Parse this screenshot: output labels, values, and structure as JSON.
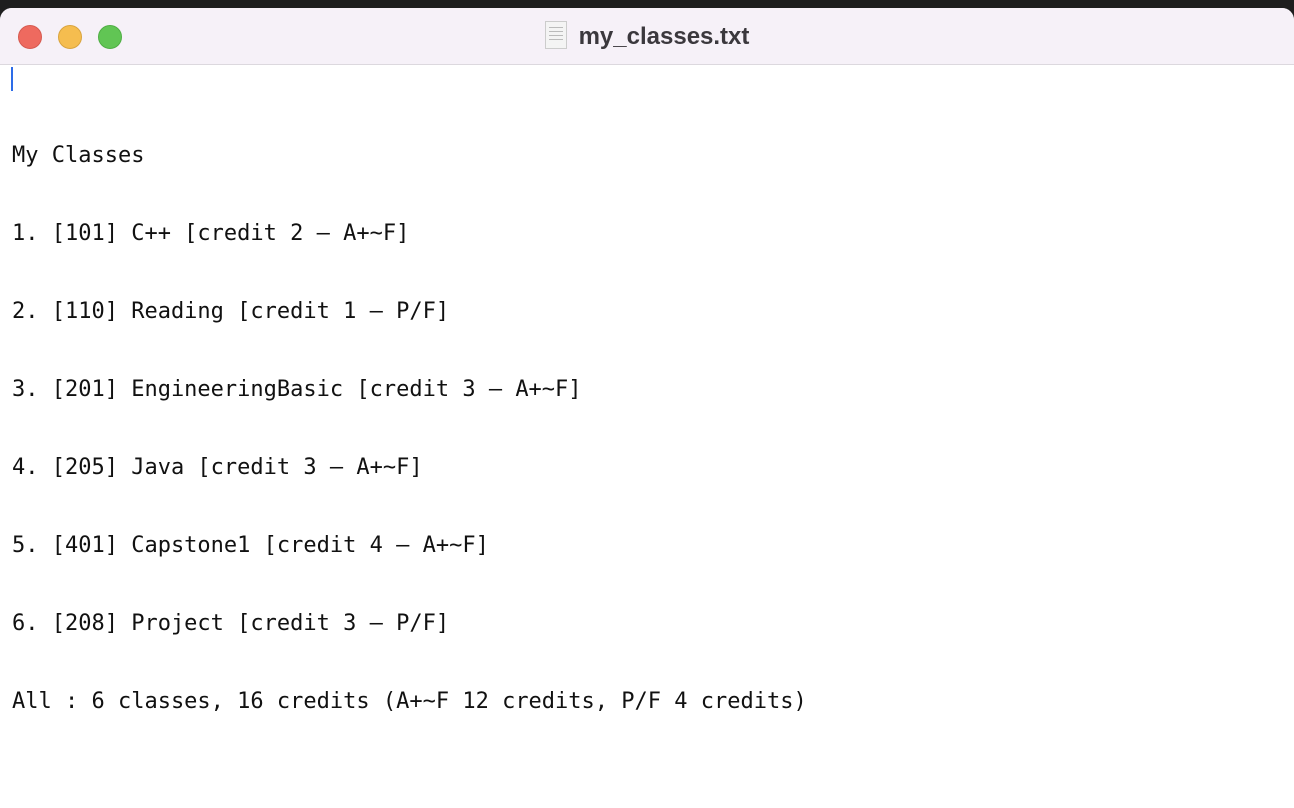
{
  "window": {
    "title": "my_classes.txt",
    "icon": "text-document-icon"
  },
  "document": {
    "lines": [
      "My Classes",
      "1. [101] C++ [credit 2 – A+~F]",
      "2. [110] Reading [credit 1 – P/F]",
      "3. [201] EngineeringBasic [credit 3 – A+~F]",
      "4. [205] Java [credit 3 – A+~F]",
      "5. [401] Capstone1 [credit 4 – A+~F]",
      "6. [208] Project [credit 3 – P/F]",
      "All : 6 classes, 16 credits (A+~F 12 credits, P/F 4 credits)"
    ]
  }
}
